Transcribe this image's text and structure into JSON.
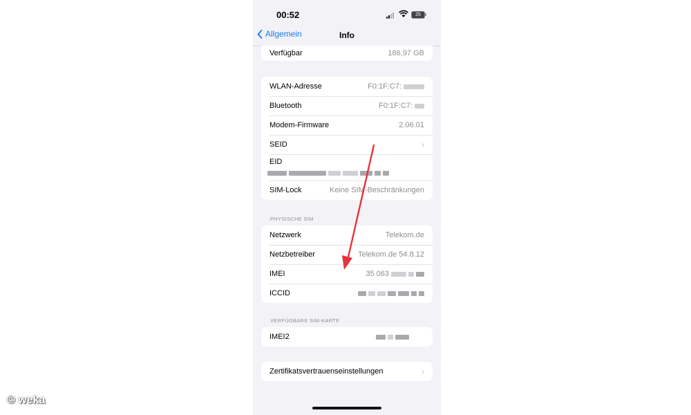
{
  "status": {
    "time": "00:52",
    "battery": "25"
  },
  "nav": {
    "back_label": "Allgemein",
    "title": "Info"
  },
  "storage": {
    "label": "Verfügbar",
    "value": "186,97 GB"
  },
  "network_group": [
    {
      "label": "WLAN-Adresse",
      "value": "F0:1F:C7:"
    },
    {
      "label": "Bluetooth",
      "value": "F0:1F:C7:"
    },
    {
      "label": "Modem-Firmware",
      "value": "2.06.01"
    },
    {
      "label": "SEID"
    },
    {
      "label": "EID"
    },
    {
      "label": "SIM-Lock",
      "value": "Keine SIM-Beschränkungen"
    }
  ],
  "physical_sim": {
    "header": "PHYSISCHE SIM",
    "rows": [
      {
        "label": "Netzwerk",
        "value": "Telekom.de"
      },
      {
        "label": "Netzbetreiber",
        "value": "Telekom.de 54.8.12"
      },
      {
        "label": "IMEI",
        "value": "35 063"
      },
      {
        "label": "ICCID"
      }
    ]
  },
  "available_sim": {
    "header": "VERFÜGBARE SIM-KARTE",
    "rows": [
      {
        "label": "IMEI2"
      }
    ]
  },
  "cert": {
    "label": "Zertifikatsvertrauenseinstellungen"
  },
  "watermark": "© weka",
  "colors": {
    "accent": "#1a7cf0",
    "arrow": "#e8323c",
    "background": "#f2f2f7"
  }
}
